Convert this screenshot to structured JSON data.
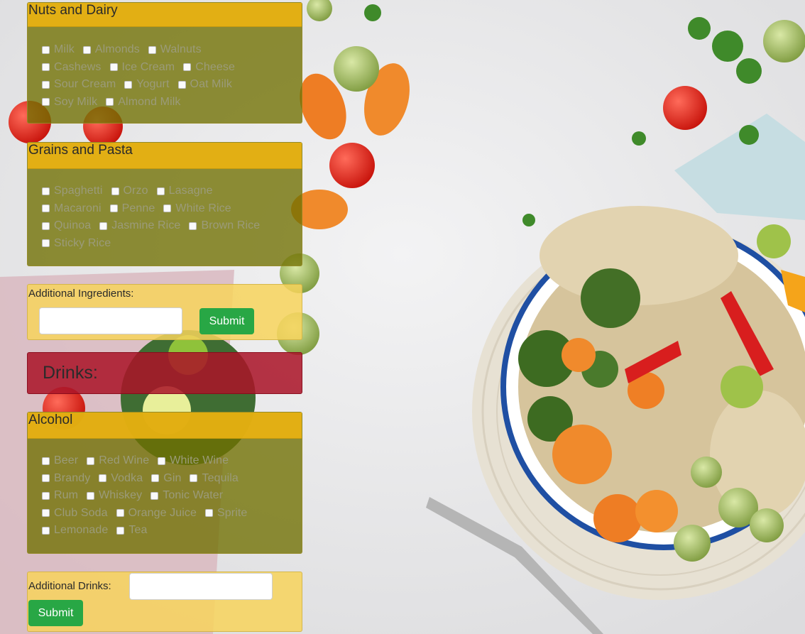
{
  "sections": {
    "nuts_dairy": {
      "title": "Nuts and Dairy",
      "rows": [
        [
          "Milk",
          "Almonds",
          "Walnuts"
        ],
        [
          "Cashews",
          "Ice Cream",
          "Cheese"
        ],
        [
          "Sour Cream",
          "Yogurt",
          "Oat Milk"
        ],
        [
          "Soy Milk",
          "Almond Milk"
        ]
      ]
    },
    "grains_pasta": {
      "title": "Grains and Pasta",
      "rows": [
        [
          "Spaghetti",
          "Orzo",
          "Lasagne"
        ],
        [
          "Macaroni",
          "Penne",
          "White Rice"
        ],
        [
          "Quinoa",
          "Jasmine Rice",
          "Brown Rice"
        ],
        [
          "Sticky Rice"
        ]
      ]
    },
    "alcohol": {
      "title": "Alcohol",
      "rows": [
        [
          "Beer",
          "Red Wine",
          "White Wine"
        ],
        [
          "Brandy",
          "Vodka",
          "Gin",
          "Tequila"
        ],
        [
          "Rum",
          "Whiskey",
          "Tonic Water"
        ],
        [
          "Club Soda",
          "Orange Juice",
          "Sprite"
        ],
        [
          "Lemonade",
          "Tea"
        ]
      ]
    }
  },
  "additional_ingredients": {
    "label": "Additional Ingredients:",
    "value": "",
    "submit_label": "Submit"
  },
  "drinks_header": {
    "title": "Drinks:"
  },
  "additional_drinks": {
    "label": "Additional Drinks:",
    "value": "",
    "submit_label": "Submit"
  },
  "colors": {
    "card_body": "#707000",
    "card_header": "#e8b212",
    "form_panel": "#f7d45c",
    "drinks_panel": "#aa1428",
    "submit_button": "#28a745"
  }
}
